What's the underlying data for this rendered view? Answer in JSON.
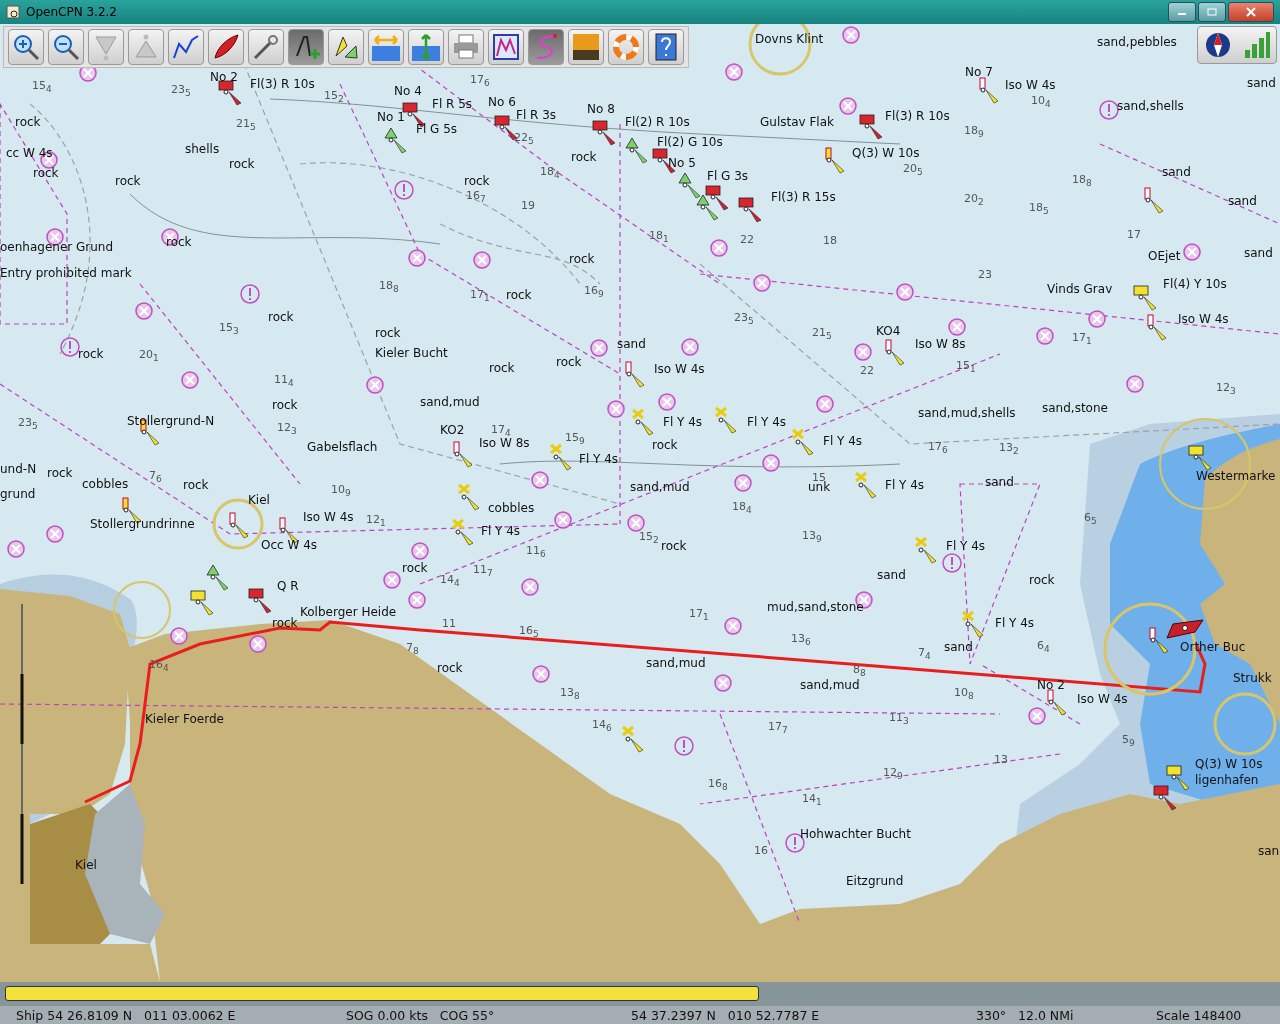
{
  "window": {
    "title": "OpenCPN 3.2.2"
  },
  "toolbar": {
    "buttons": [
      {
        "kind": "zoom-in",
        "selected": false
      },
      {
        "kind": "zoom-out",
        "selected": false
      },
      {
        "kind": "scale-down",
        "selected": false
      },
      {
        "kind": "scale-up",
        "selected": false
      },
      {
        "kind": "route",
        "selected": false
      },
      {
        "kind": "boat",
        "selected": false
      },
      {
        "kind": "tools",
        "selected": false
      },
      {
        "kind": "text",
        "selected": true
      },
      {
        "kind": "tide",
        "selected": false
      },
      {
        "kind": "width",
        "selected": false
      },
      {
        "kind": "height",
        "selected": false
      },
      {
        "kind": "print",
        "selected": false
      },
      {
        "kind": "route-manager",
        "selected": false
      },
      {
        "kind": "track",
        "selected": true
      },
      {
        "kind": "night",
        "selected": false
      },
      {
        "kind": "lifebuoy",
        "selected": false
      },
      {
        "kind": "help",
        "selected": false
      }
    ]
  },
  "chart": {
    "labels": [
      "Dovns Klint",
      "sand,pebbles",
      "No 2",
      "Fl(3) R 10s",
      "No 7",
      "Iso W 4s",
      "sand",
      "No 4",
      "Fl R 5s",
      "No 6",
      "sand,shells",
      "rock",
      "No 1",
      "Fl R 3s",
      "No 8",
      "Fl(2) R 10s",
      "Gulstav Flak",
      "Fl(3) R 10s",
      "Fl G 5s",
      "Fl(2) G 10s",
      "cc W 4s",
      "shells",
      "rock",
      "Q(3) W 10s",
      "rock",
      "No 5",
      "rock",
      "Fl G 3s",
      "sand",
      "rock",
      "rock",
      "Fl(3) R 15s",
      "sand",
      "oenhagener Grund",
      "rock",
      "rock",
      "OEjet",
      "sand",
      "Entry prohibited mark",
      "rock",
      "Vinds Grav",
      "Fl(4) Y 10s",
      "rock",
      "Iso W 4s",
      "rock",
      "KO4",
      "rock",
      "Kieler Bucht",
      "sand",
      "Iso W 8s",
      "rock",
      "rock",
      "Iso W 4s",
      "rock",
      "sand,mud",
      "sand,mud,shells",
      "sand,stone",
      "Stollergrund-N",
      "KO2",
      "Fl Y 4s",
      "Fl Y 4s",
      "Gabelsflach",
      "Iso W 8s",
      "rock",
      "Fl Y 4s",
      "Fl Y 4s",
      "und-N",
      "rock",
      "Westermarke",
      "cobbles",
      "rock",
      "sand,mud",
      "unk",
      "Fl Y 4s",
      "sand",
      "grund",
      "Kiel",
      "cobbles",
      "Stollergrundrinne",
      "Iso W 4s",
      "Fl Y 4s",
      "Occ W 4s",
      "rock",
      "Fl Y 4s",
      "rock",
      "sand",
      "Q R",
      "rock",
      "Kolberger Heide",
      "mud,sand,stone",
      "rock",
      "Fl Y 4s",
      "sand",
      "Orther Buc",
      "rock",
      "sand,mud",
      "Strukk",
      "sand,mud",
      "No 2",
      "Iso W 4s",
      "Kieler Foerde",
      "Q(3) W 10s",
      "ligenhafen",
      "Hohwachter Bucht",
      "san",
      "Kiel",
      "Eitzgrund"
    ],
    "soundings": [
      "15$_{4}$",
      "23$_{5}$",
      "21$_{5}$",
      "17$_{6}$",
      "15$_{2}$",
      "22$_{5}$",
      "18$_{4}$",
      "16$_{7}$",
      "19",
      "18$_{8}$",
      "17$_{1}$",
      "16$_{9}$",
      "15$_{3}$",
      "20$_{1}$",
      "11$_{4}$",
      "12$_{3}$",
      "23$_{5}$",
      "17$_{4}$",
      "15$_{9}$",
      "18$_{1}$",
      "22",
      "18",
      "23$_{5}$",
      "21$_{5}$",
      "22",
      "15$_{1}$",
      "17$_{1}$",
      "18$_{9}$",
      "10$_{4}$",
      "20$_{5}$",
      "18$_{8}$",
      "18$_{5}$",
      "20$_{2}$",
      "17",
      "23",
      "12$_{3}$",
      "13$_{2}$",
      "17$_{6}$",
      "15",
      "18$_{4}$",
      "15$_{2}$",
      "13$_{9}$",
      "17$_{1}$",
      "13$_{6}$",
      "7$_{4}$",
      "8$_{8}$",
      "10$_{8}$",
      "11$_{3}$",
      "17$_{7}$",
      "12$_{9}$",
      "14$_{1}$",
      "16$_{8}$",
      "16",
      "13",
      "5$_{9}$",
      "6$_{4}$",
      "6$_{5}$",
      "16$_{4}$",
      "7$_{8}$",
      "13$_{8}$",
      "14$_{6}$",
      "11",
      "16$_{5}$",
      "11$_{6}$",
      "14$_{4}$",
      "11$_{7}$",
      "10$_{9}$",
      "12$_{1}$",
      "7$_{6}$"
    ]
  },
  "progress": {
    "level": 0.595
  },
  "status_bar": {
    "ship": "Ship 54 26.8109 N   011 03.0062 E",
    "speed": "SOG 0.00 kts   COG 55°",
    "cursor": "54 37.2397 N   010 52.7787 E",
    "bearing": "330°   12.0 NMi",
    "scale": "Scale 148400"
  }
}
